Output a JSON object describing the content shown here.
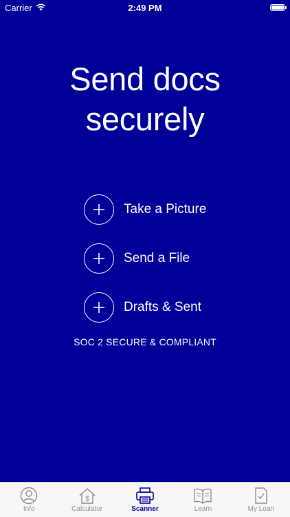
{
  "status_bar": {
    "carrier": "Carrier",
    "time": "2:49 PM"
  },
  "headline": {
    "line1": "Send docs",
    "line2": "securely"
  },
  "actions": [
    {
      "label": "Take a Picture",
      "icon": "plus-circle-icon"
    },
    {
      "label": "Send a File",
      "icon": "plus-circle-icon"
    },
    {
      "label": "Drafts & Sent",
      "icon": "plus-circle-icon"
    }
  ],
  "compliance_text": "SOC 2 SECURE & COMPLIANT",
  "tabs": [
    {
      "label": "Info",
      "icon": "person-icon",
      "active": false
    },
    {
      "label": "Calculator",
      "icon": "house-dollar-icon",
      "active": false
    },
    {
      "label": "Scanner",
      "icon": "printer-icon",
      "active": true
    },
    {
      "label": "Learn",
      "icon": "book-icon",
      "active": false
    },
    {
      "label": "My Loan",
      "icon": "document-check-icon",
      "active": false
    }
  ],
  "colors": {
    "background": "#000099",
    "text": "#ffffff",
    "tab_bar_background": "#f7f7f7",
    "tab_active": "#000099",
    "tab_inactive": "#8e8e93"
  }
}
